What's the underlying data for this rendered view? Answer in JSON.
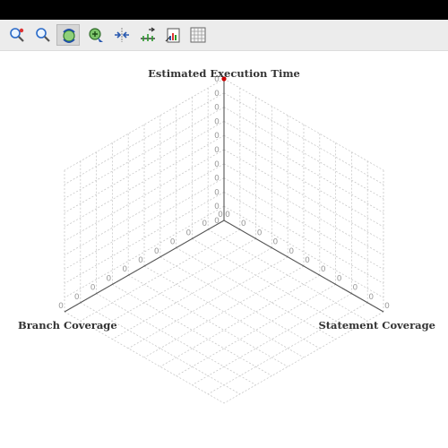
{
  "toolbar": {
    "buttons": [
      {
        "name": "zoom-in-icon",
        "active": false
      },
      {
        "name": "zoom-icon",
        "active": false
      },
      {
        "name": "rotate-icon",
        "active": true
      },
      {
        "name": "pan-icon",
        "active": false
      },
      {
        "name": "fit-icon",
        "active": false
      },
      {
        "name": "scale-icon",
        "active": false
      },
      {
        "name": "export-icon",
        "active": false
      },
      {
        "name": "grid-icon",
        "active": false
      }
    ]
  },
  "chart_data": {
    "type": "scatter",
    "projection": "isometric-3d",
    "grid": true,
    "axes": {
      "z": {
        "label": "Estimated Execution Time",
        "tick_labels": [
          "0",
          "0",
          "0",
          "0",
          "0",
          "0",
          "0",
          "0",
          "0",
          "0",
          "0"
        ]
      },
      "x": {
        "label": "Statement Coverage",
        "tick_labels": [
          "0",
          "0",
          "0",
          "0",
          "0",
          "0",
          "0",
          "0",
          "0",
          "0",
          "0"
        ]
      },
      "y": {
        "label": "Branch Coverage",
        "tick_labels": [
          "0",
          "0",
          "0",
          "0",
          "0",
          "0",
          "0",
          "0",
          "0",
          "0",
          "0"
        ]
      }
    },
    "series": [
      {
        "color": "#cc0000",
        "points": [
          {
            "x": 0,
            "y": 0,
            "z": 1
          }
        ]
      }
    ]
  }
}
